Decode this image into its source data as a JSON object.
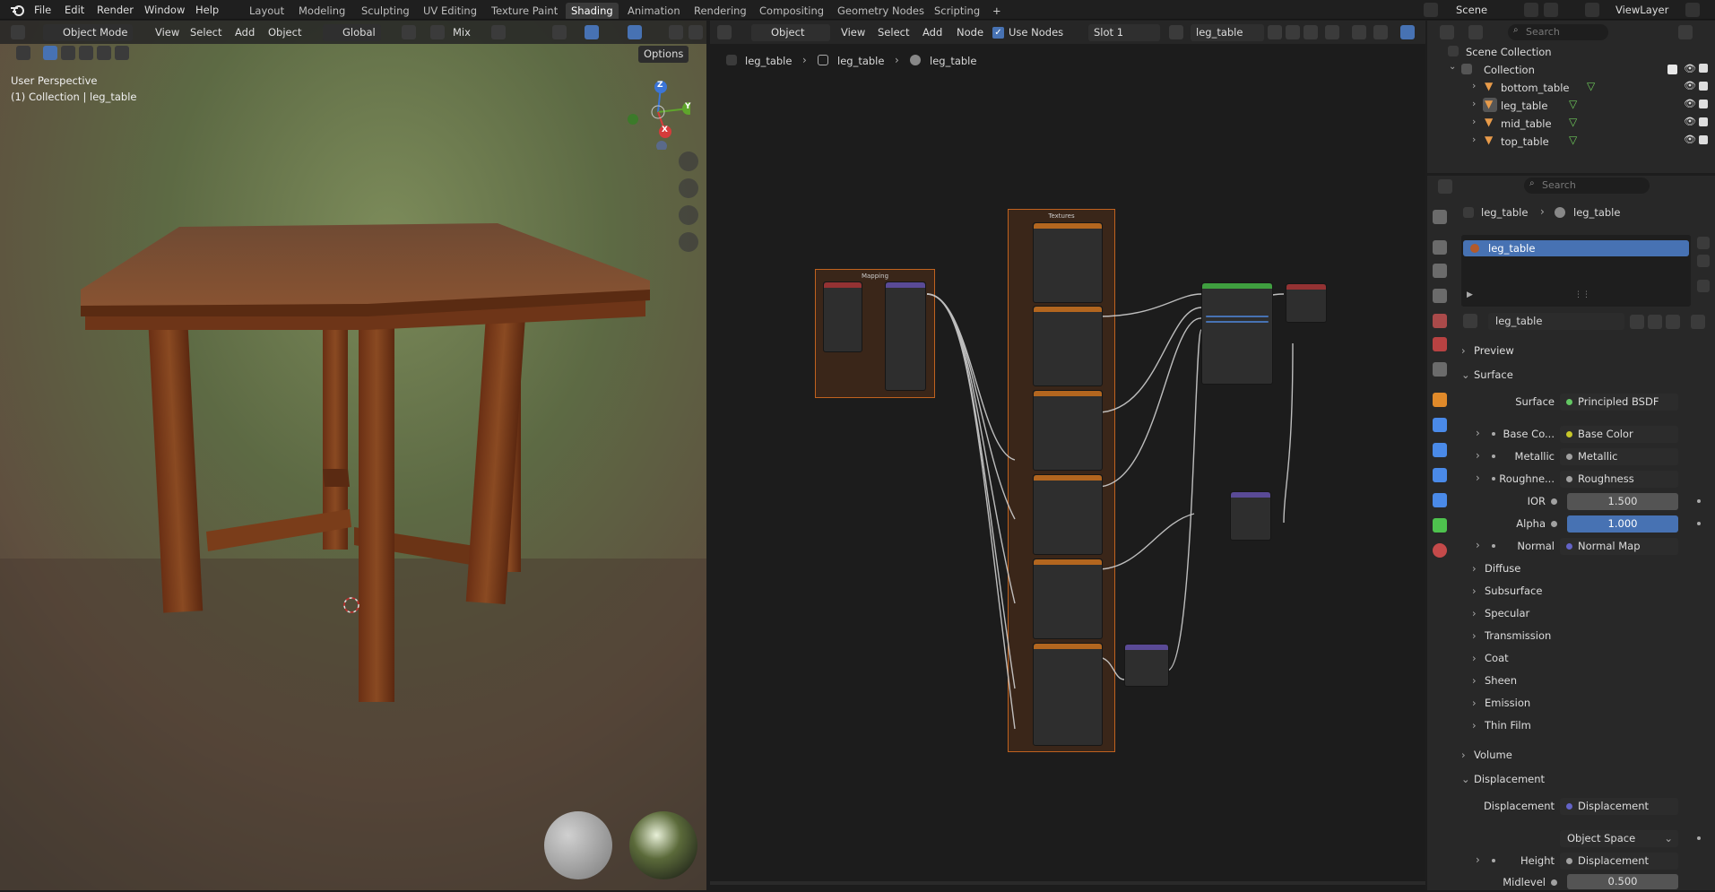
{
  "menubar": {
    "menus": [
      "File",
      "Edit",
      "Render",
      "Window",
      "Help"
    ],
    "workspaces": [
      "Layout",
      "Modeling",
      "Sculpting",
      "UV Editing",
      "Texture Paint",
      "Shading",
      "Animation",
      "Rendering",
      "Compositing",
      "Geometry Nodes",
      "Scripting"
    ],
    "active_workspace": "Shading",
    "add_tab": "+",
    "scene": "Scene",
    "view_layer": "ViewLayer"
  },
  "viewport": {
    "mode": "Object Mode",
    "menus": [
      "View",
      "Select",
      "Add",
      "Object"
    ],
    "transform_orientation": "Global",
    "blend_mode": "Mix",
    "options": "Options",
    "info_line1": "User Perspective",
    "info_line2": "(1) Collection | leg_table",
    "gizmo": {
      "x": "X",
      "y": "Y",
      "z": "Z"
    }
  },
  "node_editor": {
    "type": "Object",
    "menus": [
      "View",
      "Select",
      "Add",
      "Node"
    ],
    "use_nodes_label": "Use Nodes",
    "use_nodes_checked": true,
    "slot": "Slot 1",
    "material": "leg_table",
    "breadcrumb": [
      "leg_table",
      "leg_table",
      "leg_table"
    ],
    "frames": {
      "mapping": "Mapping",
      "textures": "Textures"
    }
  },
  "outliner": {
    "search_placeholder": "Search",
    "scene_collection": "Scene Collection",
    "collection": "Collection",
    "objects": [
      "bottom_table",
      "leg_table",
      "mid_table",
      "top_table"
    ]
  },
  "properties": {
    "search_placeholder": "Search",
    "breadcrumb": [
      "leg_table",
      "leg_table"
    ],
    "material_slot": "leg_table",
    "material_name": "leg_table",
    "sections": {
      "preview": "Preview",
      "surface": "Surface",
      "volume": "Volume",
      "displacement": "Displacement"
    },
    "surface_rows": [
      {
        "label": "Surface",
        "value": "Principled BSDF",
        "socket": "#63c763"
      },
      {
        "label": "Base Co...",
        "value": "Base Color",
        "socket": "#c7c729"
      },
      {
        "label": "Metallic",
        "value": "Metallic",
        "socket": "#a1a1a1"
      },
      {
        "label": "Roughne...",
        "value": "Roughness",
        "socket": "#a1a1a1"
      },
      {
        "label": "IOR",
        "value": "1.500",
        "socket": "#a1a1a1"
      },
      {
        "label": "Alpha",
        "value": "1.000",
        "socket": "#a1a1a1"
      },
      {
        "label": "Normal",
        "value": "Normal Map",
        "socket": "#6363c7"
      }
    ],
    "subpanels": [
      "Diffuse",
      "Subsurface",
      "Specular",
      "Transmission",
      "Coat",
      "Sheen",
      "Emission",
      "Thin Film"
    ],
    "displacement_rows": [
      {
        "label": "Displacement",
        "value": "Displacement",
        "socket": "#6363c7"
      },
      {
        "label": "",
        "value": "Object Space",
        "socket": ""
      },
      {
        "label": "Height",
        "value": "Displacement",
        "socket": "#a1a1a1"
      },
      {
        "label": "Midlevel",
        "value": "0.500",
        "socket": "#a1a1a1"
      }
    ]
  }
}
